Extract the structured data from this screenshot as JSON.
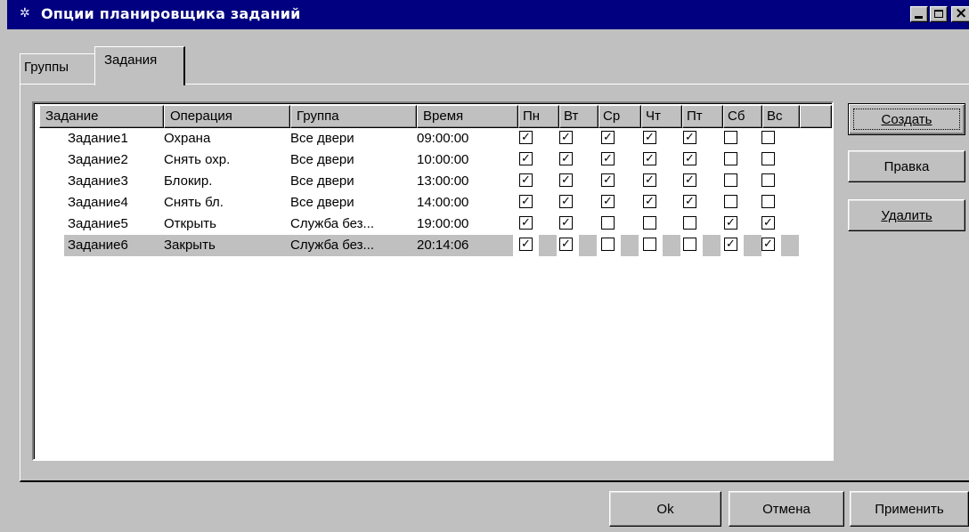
{
  "window": {
    "title": "Опции планировщика заданий",
    "icon": "gear-icon"
  },
  "tabs": [
    {
      "label": "Группы",
      "active": false
    },
    {
      "label": "Задания",
      "active": true
    }
  ],
  "table": {
    "columns": [
      "Задание",
      "Операция",
      "Группа",
      "Время",
      "Пн",
      "Вт",
      "Ср",
      "Чт",
      "Пт",
      "Сб",
      "Вс"
    ],
    "rows": [
      {
        "task": "Задание1",
        "operation": "Охрана",
        "group": "Все двери",
        "time": "09:00:00",
        "days": [
          true,
          true,
          true,
          true,
          true,
          false,
          false
        ],
        "selected": false
      },
      {
        "task": "Задание2",
        "operation": "Снять охр.",
        "group": "Все двери",
        "time": "10:00:00",
        "days": [
          true,
          true,
          true,
          true,
          true,
          false,
          false
        ],
        "selected": false
      },
      {
        "task": "Задание3",
        "operation": "Блокир.",
        "group": "Все двери",
        "time": "13:00:00",
        "days": [
          true,
          true,
          true,
          true,
          true,
          false,
          false
        ],
        "selected": false
      },
      {
        "task": "Задание4",
        "operation": "Снять бл.",
        "group": "Все двери",
        "time": "14:00:00",
        "days": [
          true,
          true,
          true,
          true,
          true,
          false,
          false
        ],
        "selected": false
      },
      {
        "task": "Задание5",
        "operation": "Открыть",
        "group": "Служба без...",
        "time": "19:00:00",
        "days": [
          true,
          true,
          false,
          false,
          false,
          true,
          true
        ],
        "selected": false
      },
      {
        "task": "Задание6",
        "operation": "Закрыть",
        "group": "Служба без...",
        "time": "20:14:06",
        "days": [
          true,
          true,
          false,
          false,
          false,
          true,
          true
        ],
        "selected": true
      }
    ]
  },
  "side_buttons": {
    "create": "Создать",
    "edit": "Правка",
    "delete": "Удалить"
  },
  "footer_buttons": {
    "ok": "Ok",
    "cancel": "Отмена",
    "apply": "Применить"
  }
}
